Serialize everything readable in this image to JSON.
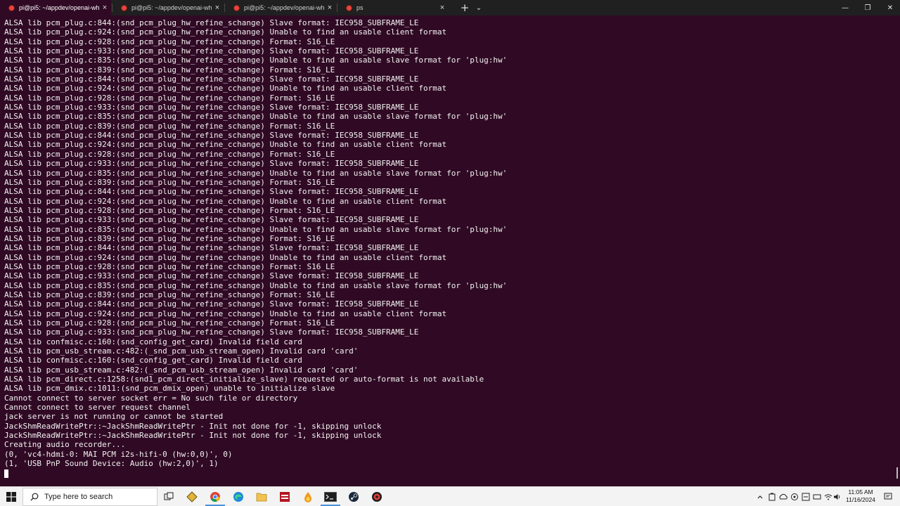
{
  "tabs": [
    {
      "title": "pi@pi5: ~/appdev/openai-whi",
      "active": true
    },
    {
      "title": "pi@pi5: ~/appdev/openai-whis",
      "active": false
    },
    {
      "title": "pi@pi5: ~/appdev/openai-whis",
      "active": false
    },
    {
      "title": "ps",
      "active": false
    }
  ],
  "tab_close_glyph": "×",
  "new_tab_glyph": "+",
  "dropdown_glyph": "⌄",
  "window_controls": {
    "minimize": "—",
    "maximize": "❐",
    "close": "✕"
  },
  "terminal": {
    "lines": [
      "ALSA lib pcm_plug.c:844:(snd_pcm_plug_hw_refine_schange) Slave format: IEC958_SUBFRAME_LE",
      "ALSA lib pcm_plug.c:924:(snd_pcm_plug_hw_refine_cchange) Unable to find an usable client format",
      "ALSA lib pcm_plug.c:928:(snd_pcm_plug_hw_refine_cchange) Format: S16_LE",
      "ALSA lib pcm_plug.c:933:(snd_pcm_plug_hw_refine_cchange) Slave format: IEC958_SUBFRAME_LE",
      "ALSA lib pcm_plug.c:835:(snd_pcm_plug_hw_refine_schange) Unable to find an usable slave format for 'plug:hw'",
      "ALSA lib pcm_plug.c:839:(snd_pcm_plug_hw_refine_schange) Format: S16_LE",
      "ALSA lib pcm_plug.c:844:(snd_pcm_plug_hw_refine_schange) Slave format: IEC958_SUBFRAME_LE",
      "ALSA lib pcm_plug.c:924:(snd_pcm_plug_hw_refine_cchange) Unable to find an usable client format",
      "ALSA lib pcm_plug.c:928:(snd_pcm_plug_hw_refine_cchange) Format: S16_LE",
      "ALSA lib pcm_plug.c:933:(snd_pcm_plug_hw_refine_cchange) Slave format: IEC958_SUBFRAME_LE",
      "ALSA lib pcm_plug.c:835:(snd_pcm_plug_hw_refine_schange) Unable to find an usable slave format for 'plug:hw'",
      "ALSA lib pcm_plug.c:839:(snd_pcm_plug_hw_refine_schange) Format: S16_LE",
      "ALSA lib pcm_plug.c:844:(snd_pcm_plug_hw_refine_schange) Slave format: IEC958_SUBFRAME_LE",
      "ALSA lib pcm_plug.c:924:(snd_pcm_plug_hw_refine_cchange) Unable to find an usable client format",
      "ALSA lib pcm_plug.c:928:(snd_pcm_plug_hw_refine_cchange) Format: S16_LE",
      "ALSA lib pcm_plug.c:933:(snd_pcm_plug_hw_refine_cchange) Slave format: IEC958_SUBFRAME_LE",
      "ALSA lib pcm_plug.c:835:(snd_pcm_plug_hw_refine_schange) Unable to find an usable slave format for 'plug:hw'",
      "ALSA lib pcm_plug.c:839:(snd_pcm_plug_hw_refine_schange) Format: S16_LE",
      "ALSA lib pcm_plug.c:844:(snd_pcm_plug_hw_refine_schange) Slave format: IEC958_SUBFRAME_LE",
      "ALSA lib pcm_plug.c:924:(snd_pcm_plug_hw_refine_cchange) Unable to find an usable client format",
      "ALSA lib pcm_plug.c:928:(snd_pcm_plug_hw_refine_cchange) Format: S16_LE",
      "ALSA lib pcm_plug.c:933:(snd_pcm_plug_hw_refine_cchange) Slave format: IEC958_SUBFRAME_LE",
      "ALSA lib pcm_plug.c:835:(snd_pcm_plug_hw_refine_schange) Unable to find an usable slave format for 'plug:hw'",
      "ALSA lib pcm_plug.c:839:(snd_pcm_plug_hw_refine_schange) Format: S16_LE",
      "ALSA lib pcm_plug.c:844:(snd_pcm_plug_hw_refine_schange) Slave format: IEC958_SUBFRAME_LE",
      "ALSA lib pcm_plug.c:924:(snd_pcm_plug_hw_refine_cchange) Unable to find an usable client format",
      "ALSA lib pcm_plug.c:928:(snd_pcm_plug_hw_refine_cchange) Format: S16_LE",
      "ALSA lib pcm_plug.c:933:(snd_pcm_plug_hw_refine_cchange) Slave format: IEC958_SUBFRAME_LE",
      "ALSA lib pcm_plug.c:835:(snd_pcm_plug_hw_refine_schange) Unable to find an usable slave format for 'plug:hw'",
      "ALSA lib pcm_plug.c:839:(snd_pcm_plug_hw_refine_schange) Format: S16_LE",
      "ALSA lib pcm_plug.c:844:(snd_pcm_plug_hw_refine_schange) Slave format: IEC958_SUBFRAME_LE",
      "ALSA lib pcm_plug.c:924:(snd_pcm_plug_hw_refine_cchange) Unable to find an usable client format",
      "ALSA lib pcm_plug.c:928:(snd_pcm_plug_hw_refine_cchange) Format: S16_LE",
      "ALSA lib pcm_plug.c:933:(snd_pcm_plug_hw_refine_cchange) Slave format: IEC958_SUBFRAME_LE",
      "ALSA lib confmisc.c:160:(snd_config_get_card) Invalid field card",
      "ALSA lib pcm_usb_stream.c:482:(_snd_pcm_usb_stream_open) Invalid card 'card'",
      "ALSA lib confmisc.c:160:(snd_config_get_card) Invalid field card",
      "ALSA lib pcm_usb_stream.c:482:(_snd_pcm_usb_stream_open) Invalid card 'card'",
      "ALSA lib pcm_direct.c:1258:(snd1_pcm_direct_initialize_slave) requested or auto-format is not available",
      "ALSA lib pcm_dmix.c:1011:(snd_pcm_dmix_open) unable to initialize slave",
      "Cannot connect to server socket err = No such file or directory",
      "Cannot connect to server request channel",
      "jack server is not running or cannot be started",
      "JackShmReadWritePtr::~JackShmReadWritePtr - Init not done for -1, skipping unlock",
      "JackShmReadWritePtr::~JackShmReadWritePtr - Init not done for -1, skipping unlock",
      "Creating audio recorder...",
      "(0, 'vc4-hdmi-0: MAI PCM i2s-hifi-0 (hw:0,0)', 0)",
      "(1, 'USB PnP Sound Device: Audio (hw:2,0)', 1)"
    ]
  },
  "taskbar": {
    "search_placeholder": "Type here to search",
    "icons": [
      "windows-start-icon",
      "task-view-icon",
      "app-icon",
      "chrome-icon",
      "edge-icon",
      "file-explorer-icon",
      "app-icon",
      "app-icon",
      "terminal-icon",
      "steam-icon",
      "app-icon"
    ],
    "tray_icons": [
      "chevron-up-icon",
      "tray-icon",
      "tray-icon",
      "tray-icon",
      "tray-icon",
      "tray-icon",
      "tray-icon",
      "wifi-icon",
      "volume-icon"
    ],
    "time": "11:05 AM",
    "date": "11/16/2024"
  },
  "colors": {
    "terminal_bg": "#300a24",
    "terminal_fg": "#f2f2f2",
    "tabbar_bg": "#202020",
    "taskbar_bg": "#f3f3f3"
  }
}
